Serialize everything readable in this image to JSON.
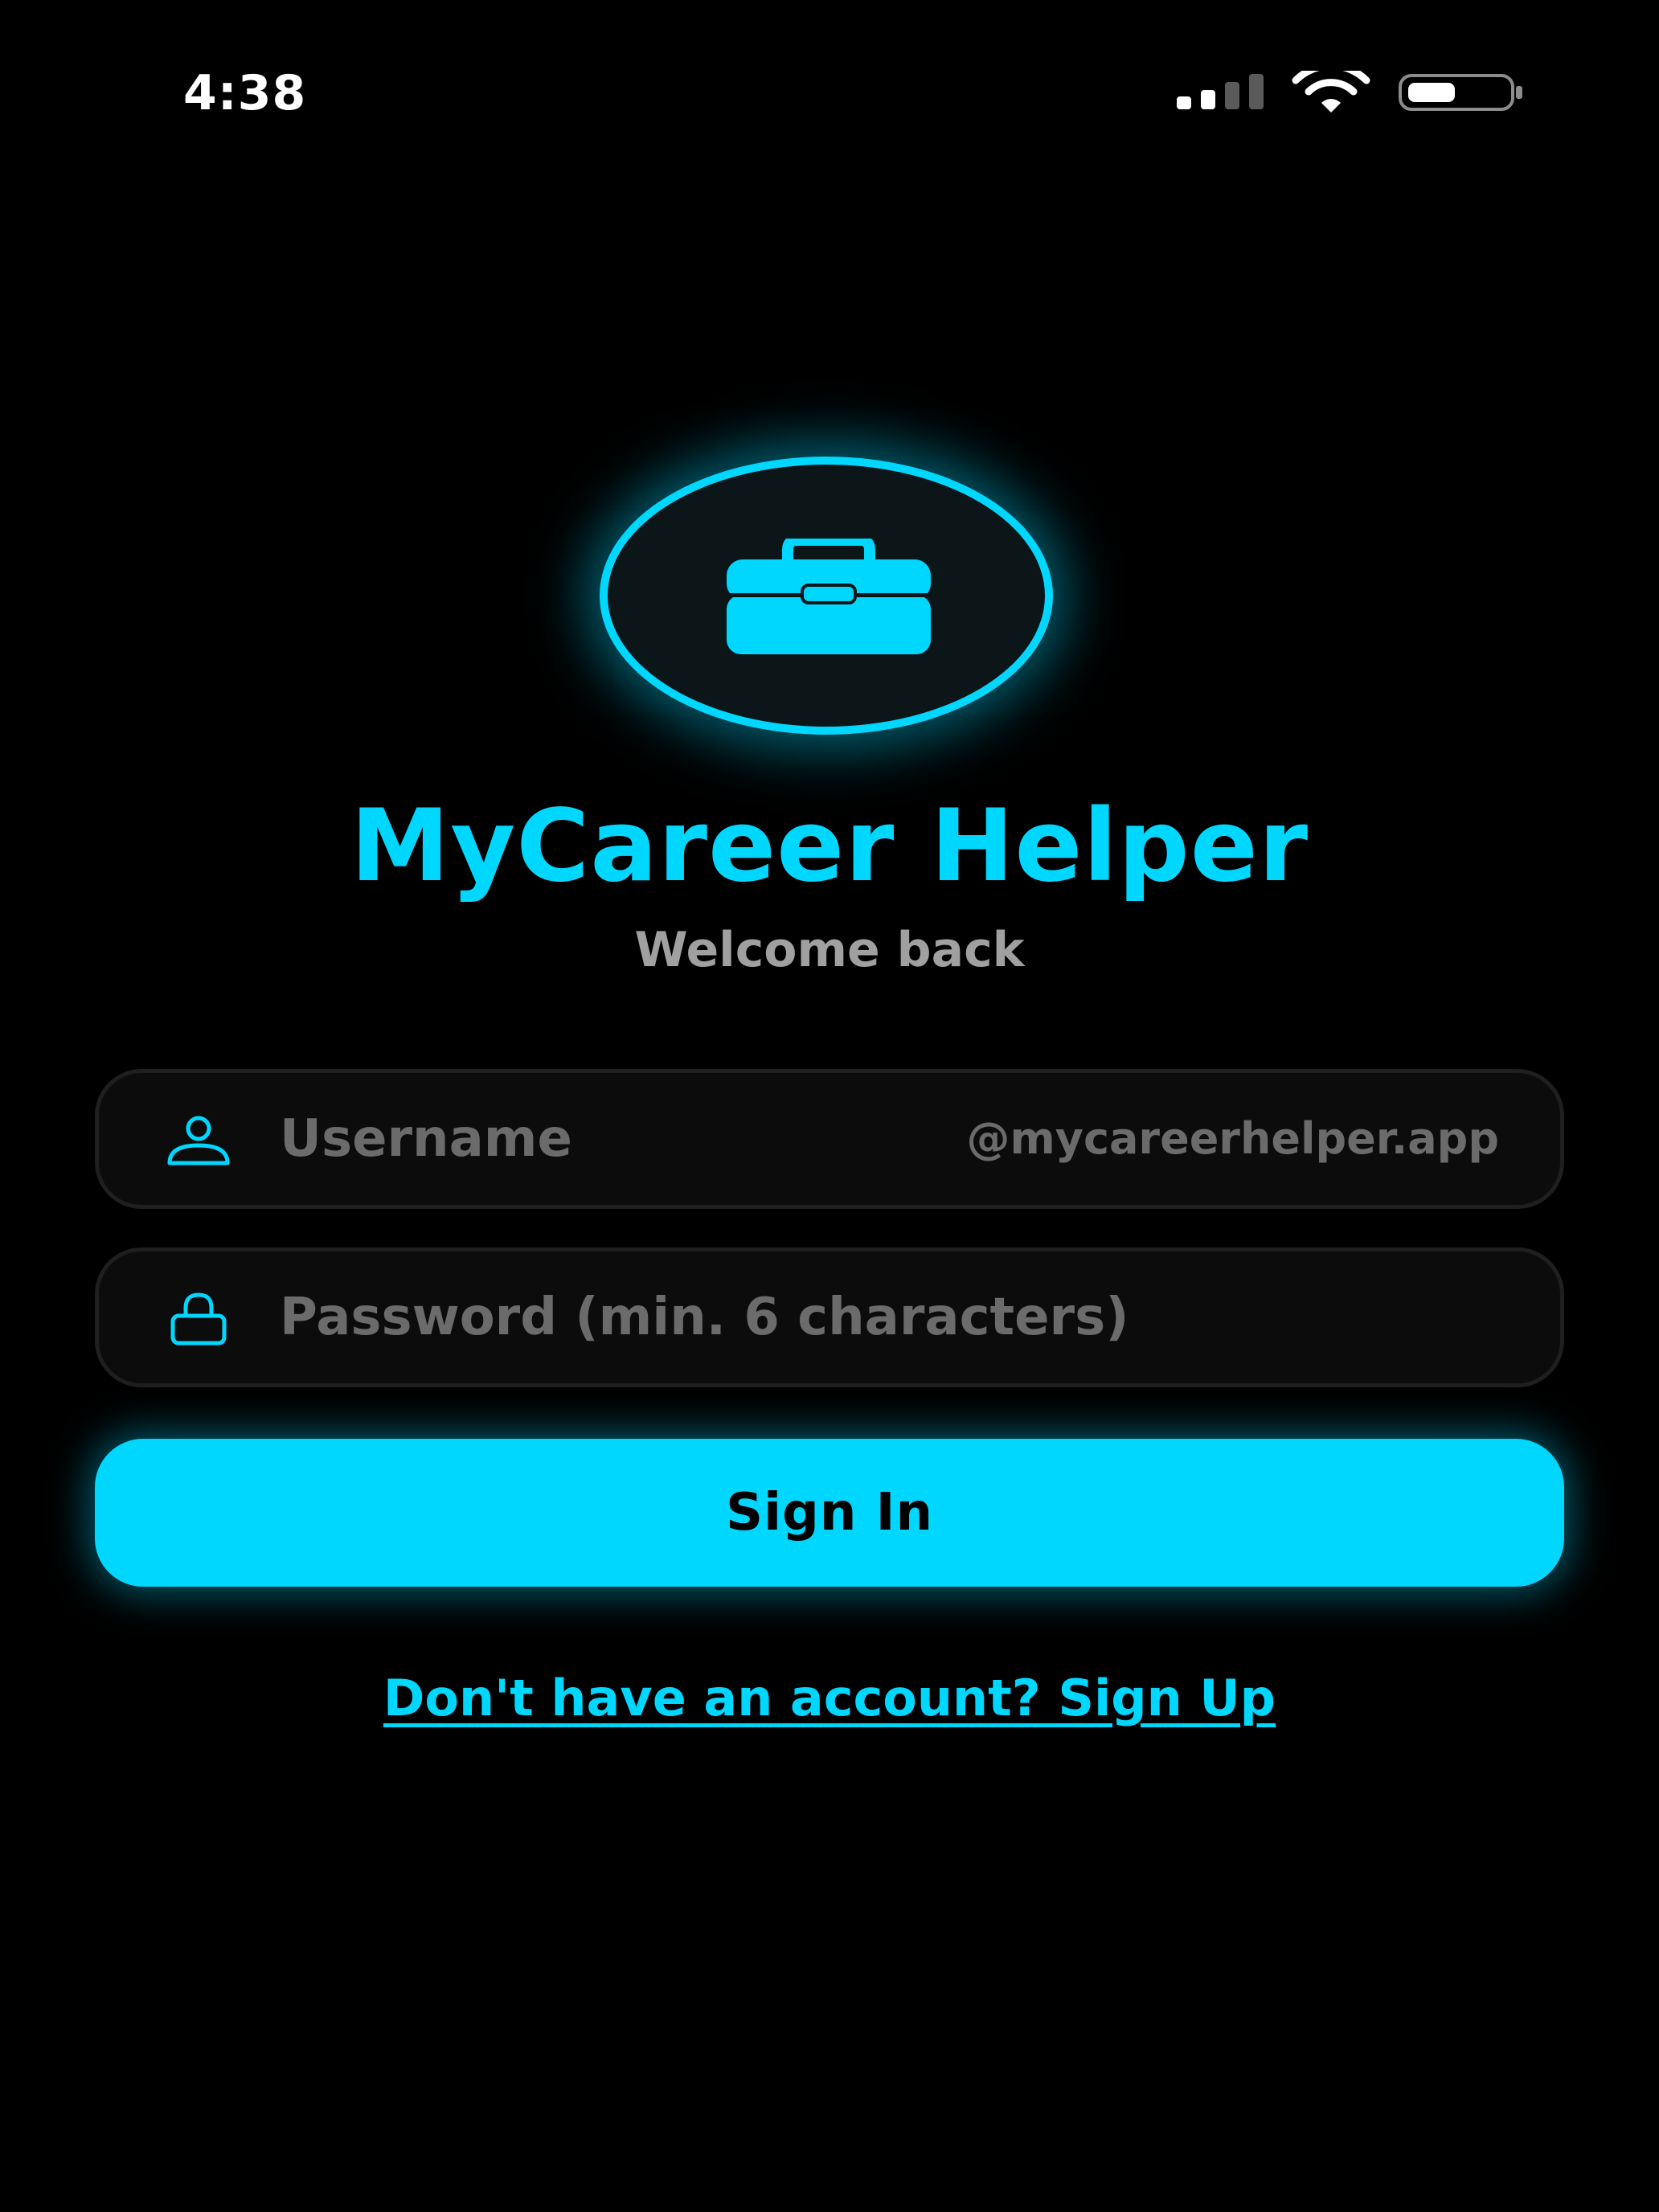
{
  "status_bar": {
    "time": "4:38",
    "icons": [
      "moon-icon",
      "signal-icon",
      "wifi-icon",
      "battery-icon"
    ]
  },
  "logo": {
    "icon": "briefcase-icon"
  },
  "header": {
    "title": "MyCareer Helper",
    "subtitle": "Welcome back"
  },
  "form": {
    "username": {
      "icon": "user-icon",
      "value": "",
      "placeholder": "Username",
      "suffix": "@mycareerhelper.app"
    },
    "password": {
      "icon": "lock-icon",
      "value": "",
      "placeholder": "Password (min. 6 characters)"
    },
    "submit_label": "Sign In",
    "signup_link": "Don't have an account? Sign Up"
  },
  "colors": {
    "background": "#000000",
    "accent": "#00d7ff",
    "field_background": "#0c0c0c",
    "field_border": "#1f1f1f",
    "placeholder": "#6b6b6b",
    "subtitle": "#a0a0a0"
  }
}
